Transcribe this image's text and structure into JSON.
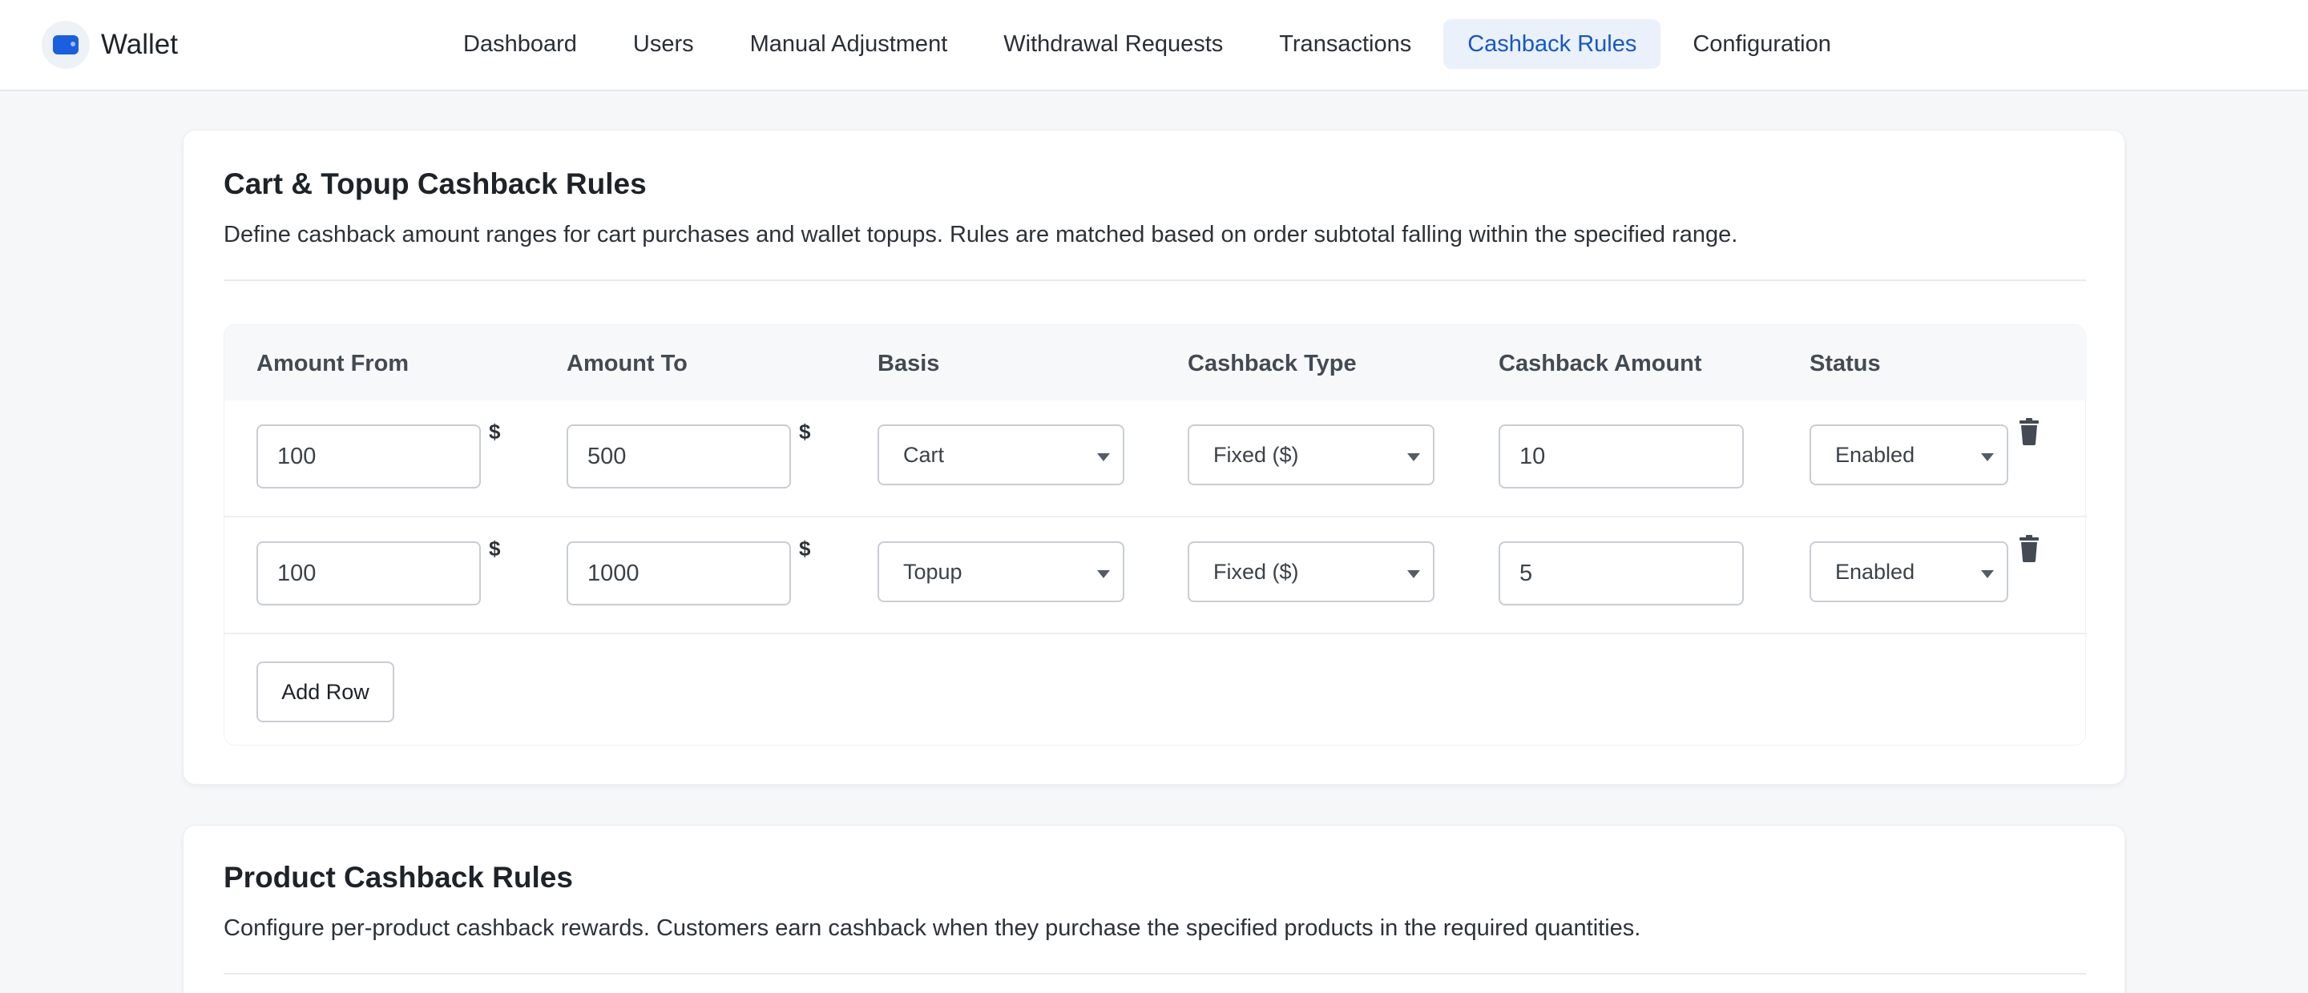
{
  "app": {
    "name": "Wallet"
  },
  "nav": {
    "items": [
      {
        "label": "Dashboard"
      },
      {
        "label": "Users"
      },
      {
        "label": "Manual Adjustment"
      },
      {
        "label": "Withdrawal Requests"
      },
      {
        "label": "Transactions"
      },
      {
        "label": "Cashback Rules",
        "active": true
      },
      {
        "label": "Configuration"
      }
    ]
  },
  "cart_rules": {
    "title": "Cart & Topup Cashback Rules",
    "description": "Define cashback amount ranges for cart purchases and wallet topups. Rules are matched based on order subtotal falling within the specified range.",
    "columns": [
      "Amount From",
      "Amount To",
      "Basis",
      "Cashback Type",
      "Cashback Amount",
      "Status"
    ],
    "currency_suffix": "$",
    "rows": [
      {
        "amount_from": "100",
        "amount_to": "500",
        "basis": "Cart",
        "cashback_type": "Fixed ($)",
        "cashback_amount": "10",
        "status": "Enabled"
      },
      {
        "amount_from": "100",
        "amount_to": "1000",
        "basis": "Topup",
        "cashback_type": "Fixed ($)",
        "cashback_amount": "5",
        "status": "Enabled"
      }
    ],
    "add_row_label": "Add Row"
  },
  "product_rules": {
    "title": "Product Cashback Rules",
    "description": "Configure per-product cashback rewards. Customers earn cashback when they purchase the specified products in the required quantities."
  },
  "colors": {
    "accent": "#1657c9",
    "active_tab_bg": "#eaf1fb",
    "page_bg": "#f6f7f9"
  },
  "icons": {
    "brand": "wallet-icon",
    "row_delete": "trash-icon",
    "select_caret": "caret-down-icon"
  }
}
